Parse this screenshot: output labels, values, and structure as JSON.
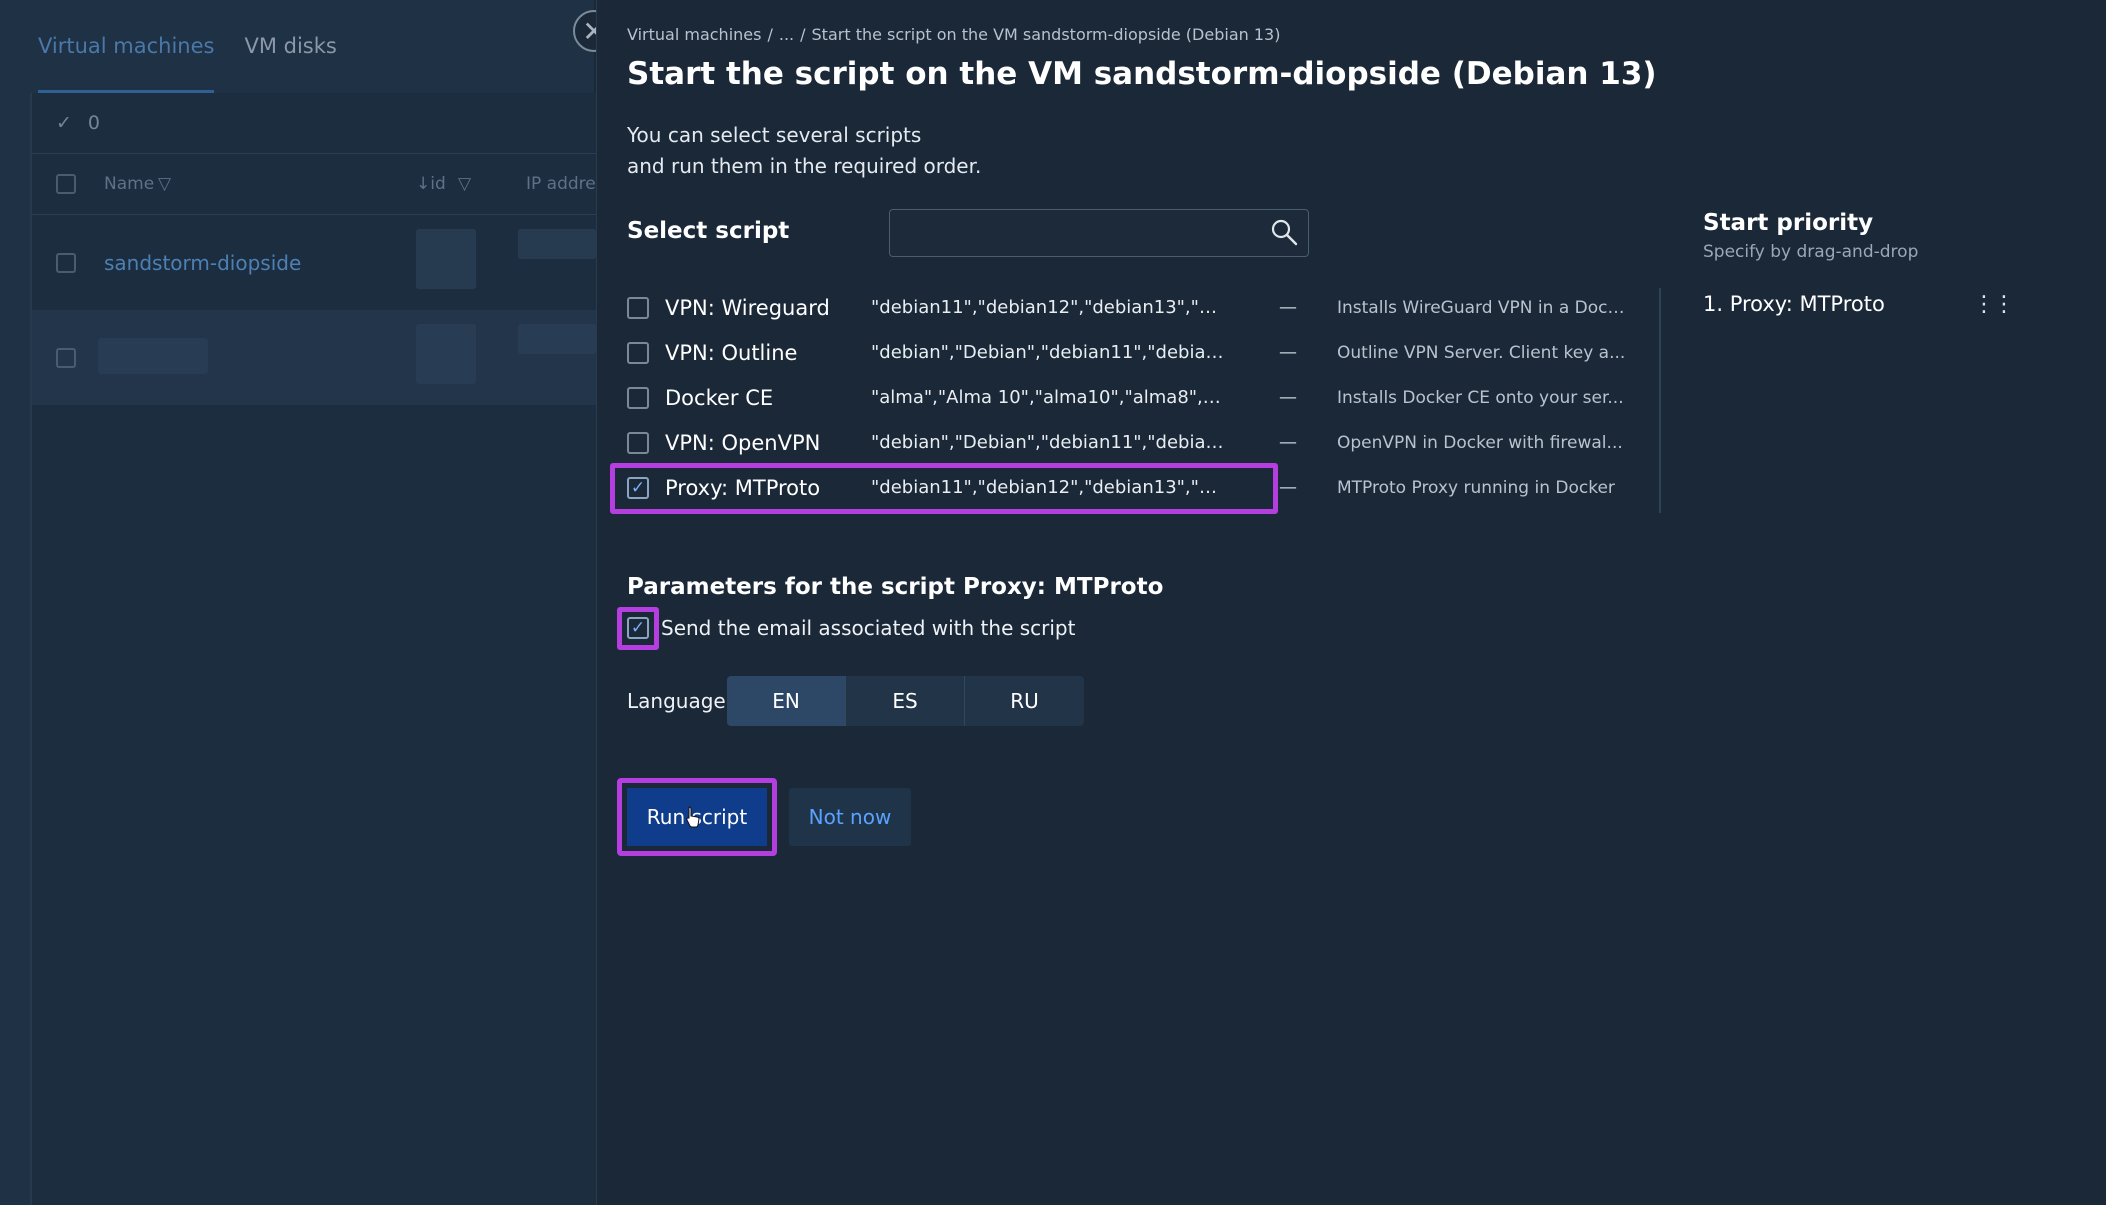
{
  "background": {
    "tabs": [
      "Virtual machines",
      "VM disks"
    ],
    "selected_count": "0",
    "columns": {
      "name": "Name",
      "id": "↓id",
      "ip": "IP addre"
    },
    "rows": [
      "sandstorm-diopside"
    ]
  },
  "dialog": {
    "breadcrumb": [
      "Virtual machines",
      "/",
      "...",
      "/",
      "Start the script on the VM sandstorm-diopside (Debian 13)"
    ],
    "title": "Start the script on the VM sandstorm-diopside (Debian 13)",
    "description_line1": "You can select several scripts",
    "description_line2": "and run them in the required order.",
    "select_label": "Select script",
    "search_placeholder": "",
    "scripts": [
      {
        "name": "VPN: Wireguard",
        "os": "\"debian11\",\"debian12\",\"debian13\",\"ubun...",
        "dash": "—",
        "desc": "Installs WireGuard VPN in a Dock...",
        "checked": false
      },
      {
        "name": "VPN: Outline",
        "os": "\"debian\",\"Debian\",\"debian11\",\"debian12\",...",
        "dash": "—",
        "desc": "Outline VPN Server. Client key a...",
        "checked": false
      },
      {
        "name": "Docker CE",
        "os": "\"alma\",\"Alma 10\",\"alma10\",\"alma8\",\"alma...",
        "dash": "—",
        "desc": "Installs Docker CE onto your ser...",
        "checked": false
      },
      {
        "name": "VPN: OpenVPN",
        "os": "\"debian\",\"Debian\",\"debian11\",\"debian12\",...",
        "dash": "—",
        "desc": "OpenVPN in Docker with firewal...",
        "checked": false
      },
      {
        "name": "Proxy: MTProto",
        "os": "\"debian11\",\"debian12\",\"debian13\",\"ubun...",
        "dash": "—",
        "desc": "MTProto Proxy running in Docker",
        "checked": true
      }
    ],
    "priority": {
      "title": "Start priority",
      "subtitle": "Specify by drag-and-drop",
      "items": [
        "1.  Proxy: MTProto"
      ]
    },
    "params_title": "Parameters for the script Proxy: MTProto",
    "email_label": "Send the email associated with the script",
    "language_label": "Language",
    "languages": [
      "EN",
      "ES",
      "RU"
    ],
    "selected_language": "EN",
    "run_button": "Run script",
    "later_button": "Not now",
    "check_mark": "✓"
  },
  "colors": {
    "accent": "#b43ee0",
    "primary_button": "#0f3d8c",
    "link": "#5aa2ff",
    "background": "#1b2838"
  }
}
